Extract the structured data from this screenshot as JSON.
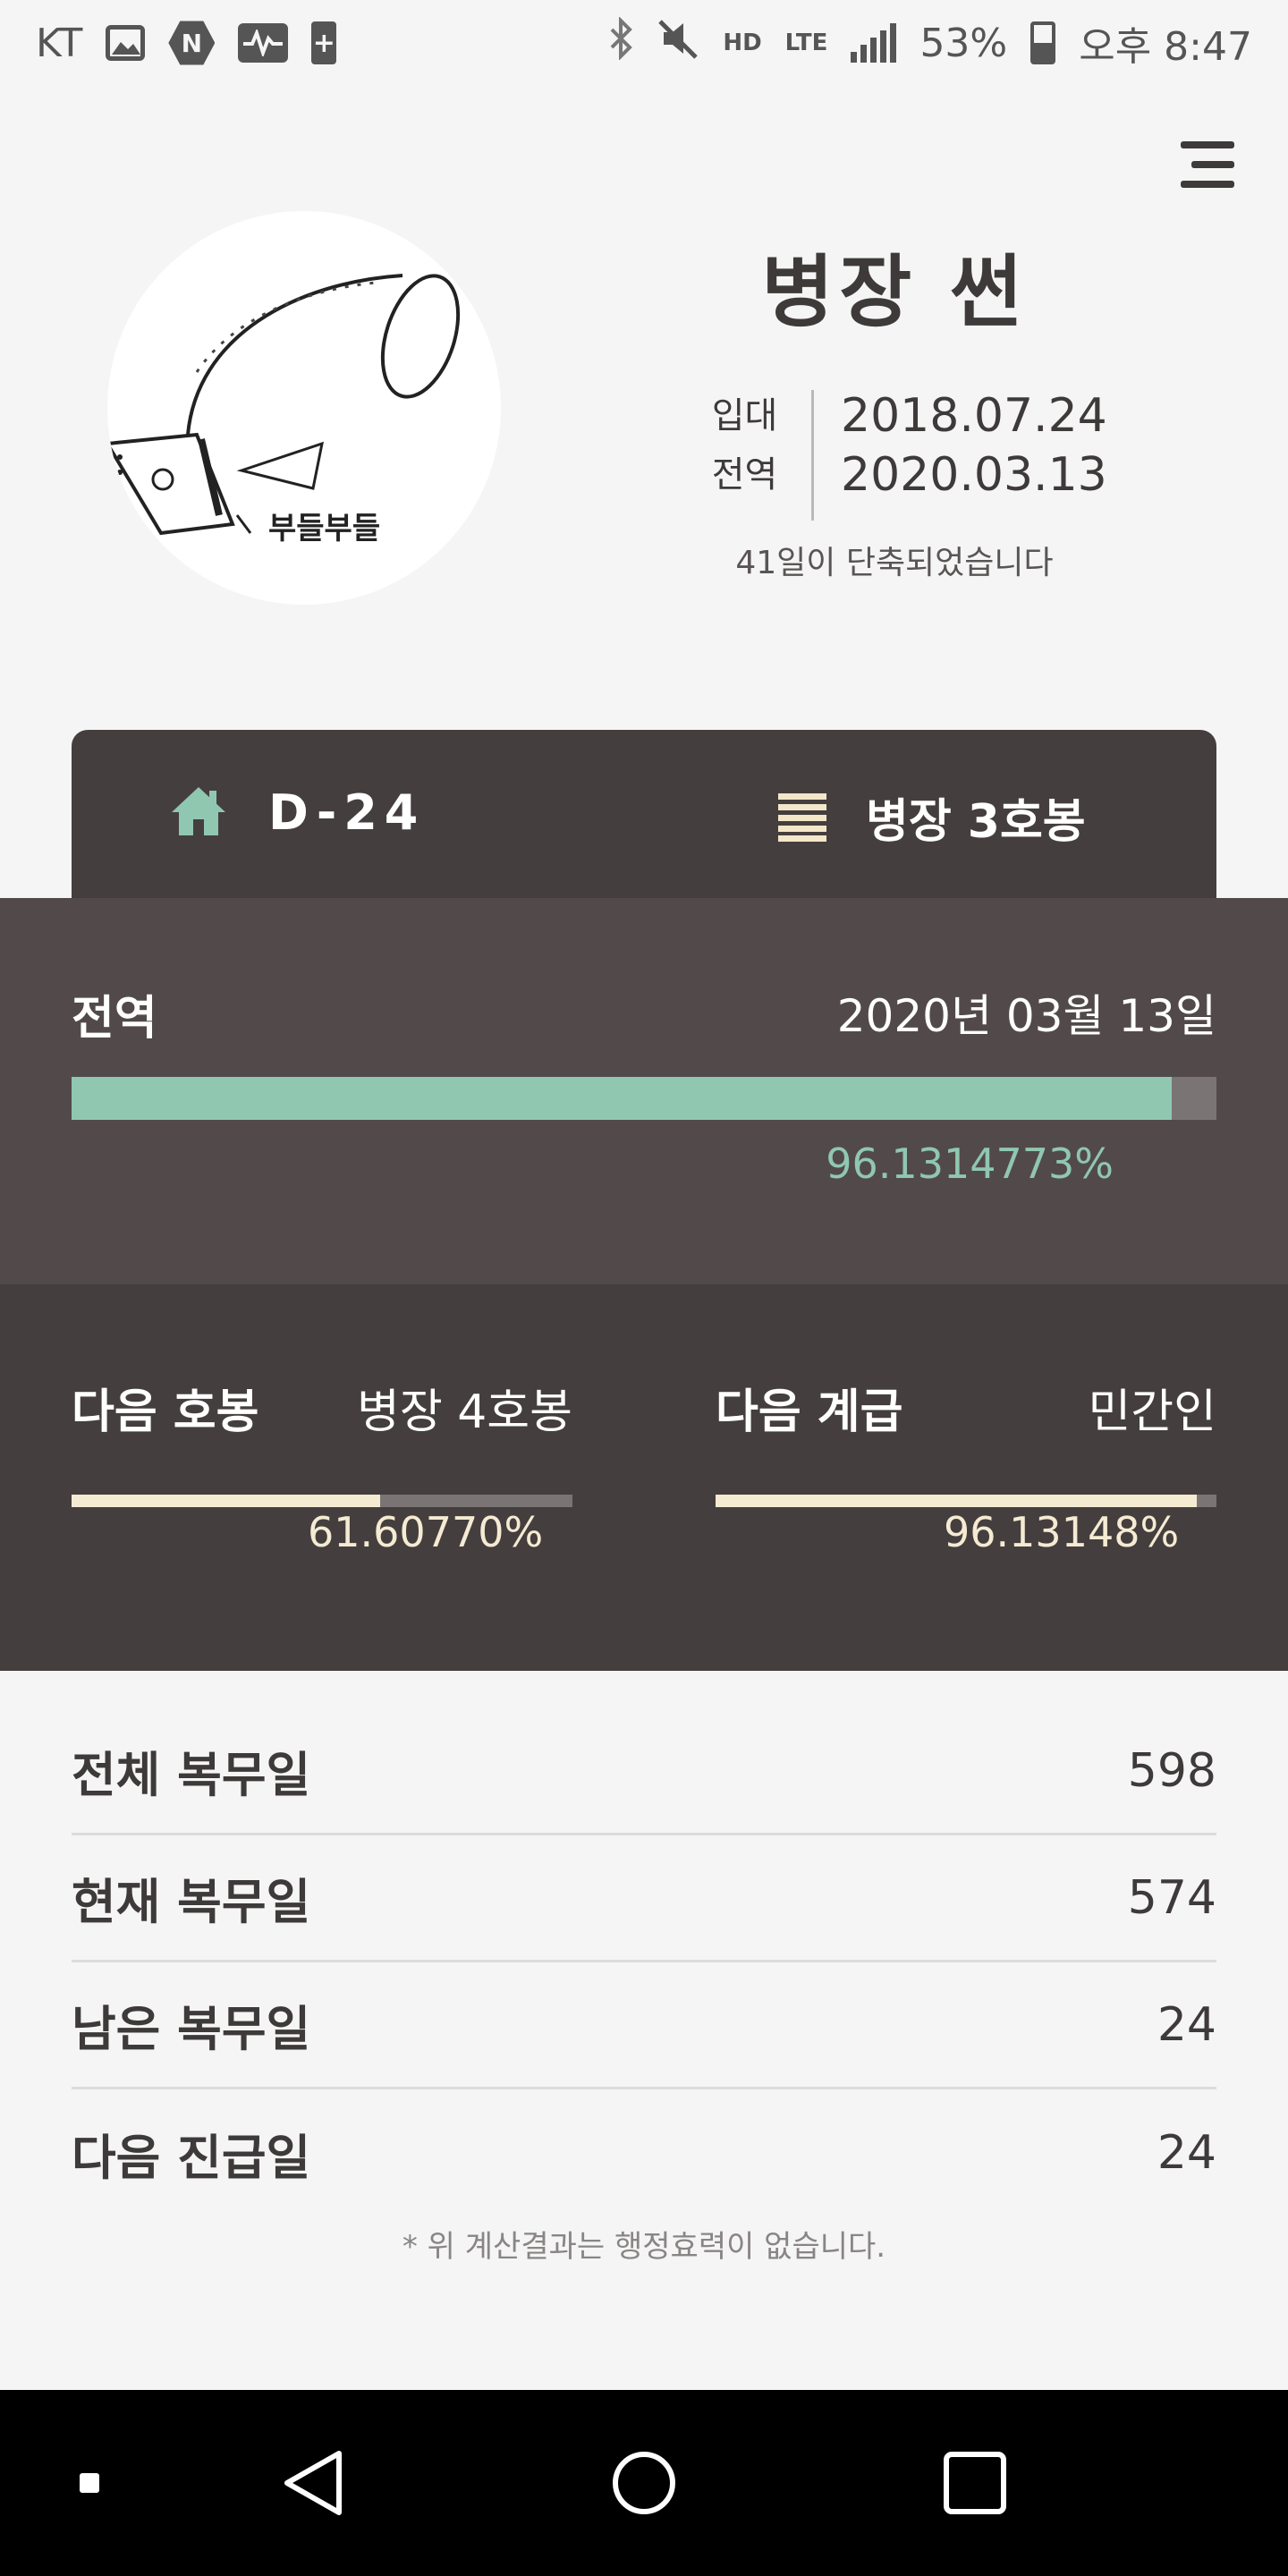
{
  "status_bar": {
    "carrier": "KT",
    "n_badge": "N",
    "lte": "LTE",
    "hd": "HD",
    "battery": "53%",
    "time": "오후 8:47"
  },
  "avatar": {
    "caption": "부들부들"
  },
  "profile": {
    "rank_title": "병장 썬",
    "enlist_label": "입대",
    "enlist_date": "2018.07.24",
    "discharge_label": "전역",
    "discharge_date": "2020.03.13",
    "shortened_note": "41일이 단축되었습니다"
  },
  "dday": {
    "label": "D-24",
    "current_rank": "병장 3호봉"
  },
  "discharge": {
    "label": "전역",
    "date": "2020년 03월 13일",
    "progress_percent": 96.1314773,
    "progress_text": "96.1314773%"
  },
  "next": {
    "pay": {
      "label": "다음 호봉",
      "target": "병장 4호봉",
      "progress_percent": 61.6077,
      "progress_text": "61.60770%"
    },
    "rank": {
      "label": "다음 계급",
      "target": "민간인",
      "progress_percent": 96.13148,
      "progress_text": "96.13148%"
    }
  },
  "stats": [
    {
      "label": "전체 복무일",
      "value": "598"
    },
    {
      "label": "현재 복무일",
      "value": "574"
    },
    {
      "label": "남은 복무일",
      "value": "24"
    },
    {
      "label": "다음 진급일",
      "value": "24"
    }
  ],
  "disclaimer": "* 위 계산결과는 행정효력이 없습니다.",
  "colors": {
    "accent_green": "#90c7b0",
    "accent_cream": "#f5ebd3",
    "dark_bg": "#453e3e",
    "mid_bg": "#524a4a"
  },
  "icons": {
    "menu": "hamburger-icon",
    "home": "home-icon",
    "rank": "list-icon",
    "nav_back": "back-triangle-icon",
    "nav_home": "home-circle-icon",
    "nav_recent": "recents-square-icon"
  }
}
